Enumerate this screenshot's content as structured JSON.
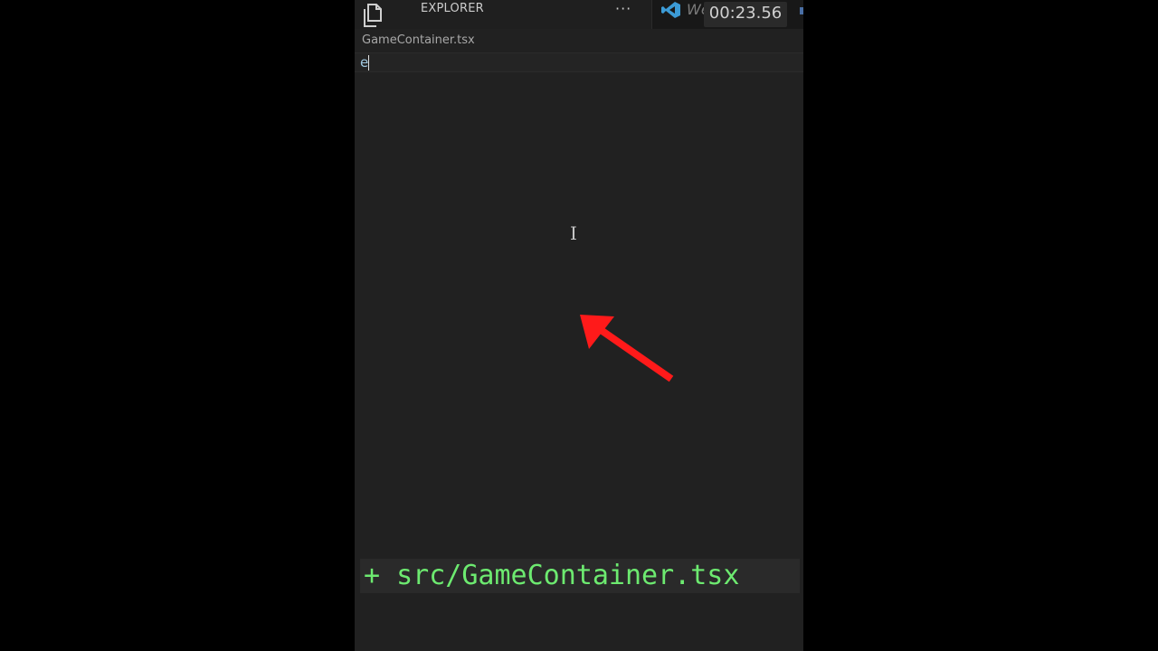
{
  "sidebar": {
    "title": "EXPLORER",
    "more_label": "···",
    "files_icon": "files-icon"
  },
  "editor_tab": {
    "label": "Welcome",
    "icon": "vscode-icon",
    "accent": "#3c9bd6"
  },
  "timer": {
    "value": "00:23.56"
  },
  "new_file": {
    "label": "GameContainer.tsx",
    "input_value": "e"
  },
  "overlay": {
    "arrow_icon": "red-arrow-icon",
    "arrow_color": "#ff1a1a",
    "caption": "+ src/GameContainer.tsx",
    "caption_color": "#6dea70"
  }
}
